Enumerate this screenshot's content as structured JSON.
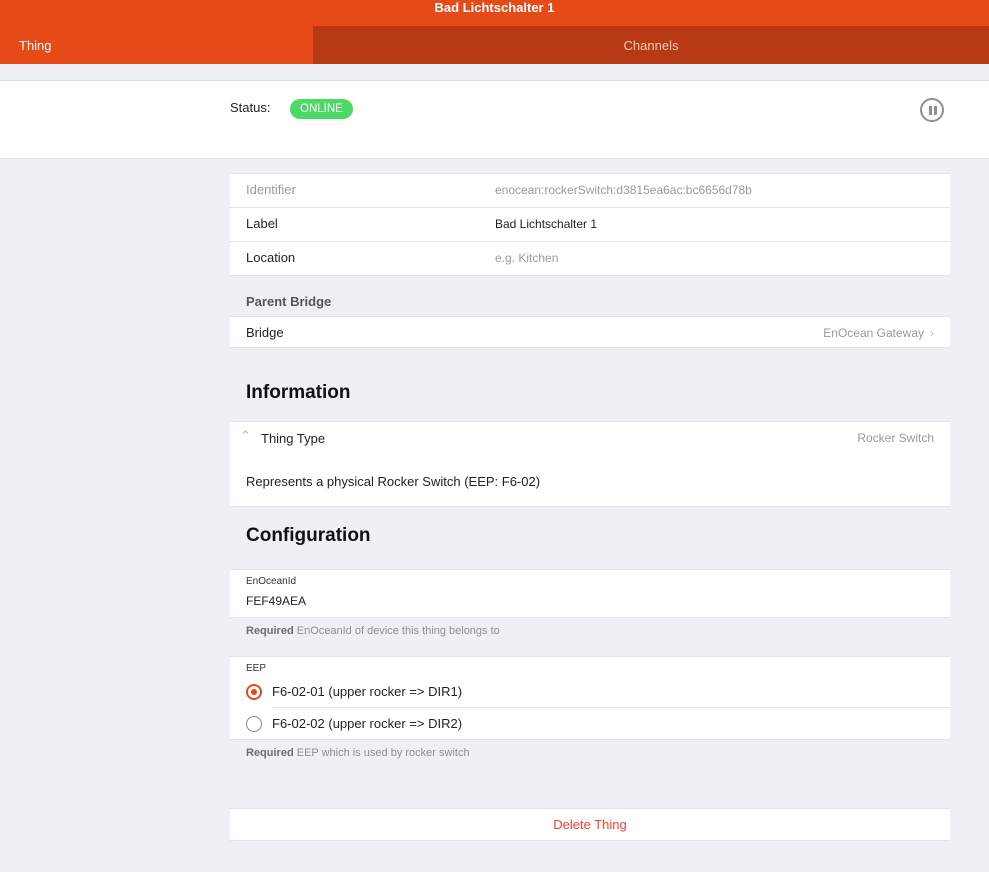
{
  "header": {
    "title": "Bad Lichtschalter 1"
  },
  "tabs": {
    "thing": "Thing",
    "channels": "Channels"
  },
  "status": {
    "label": "Status:",
    "value": "ONLINE"
  },
  "fields": {
    "identifier": {
      "label": "Identifier",
      "value": "enocean:rockerSwitch:d3815ea6ac:bc6656d78b"
    },
    "label": {
      "label": "Label",
      "value": "Bad Lichtschalter  1"
    },
    "location": {
      "label": "Location",
      "placeholder": "e.g. Kitchen"
    }
  },
  "parent_bridge": {
    "heading": "Parent Bridge",
    "label": "Bridge",
    "value": "EnOcean Gateway"
  },
  "information": {
    "heading": "Information",
    "thing_type_label": "Thing Type",
    "thing_type_value": "Rocker Switch",
    "description": "Represents a physical Rocker Switch (EEP: F6-02)"
  },
  "configuration": {
    "heading": "Configuration",
    "enocean_id": {
      "label": "EnOceanId",
      "value": "FEF49AEA",
      "hint_required": "Required",
      "hint_text": "EnOceanId of device this thing belongs to"
    },
    "eep": {
      "label": "EEP",
      "options": [
        {
          "label": "F6-02-01 (upper rocker => DIR1)",
          "selected": true
        },
        {
          "label": "F6-02-02 (upper rocker => DIR2)",
          "selected": false
        }
      ],
      "hint_required": "Required",
      "hint_text": "EEP which is used by rocker switch"
    }
  },
  "actions": {
    "delete": "Delete Thing"
  },
  "colors": {
    "accent": "#e64a19",
    "online": "#4cd964",
    "danger": "#ff3b30"
  }
}
